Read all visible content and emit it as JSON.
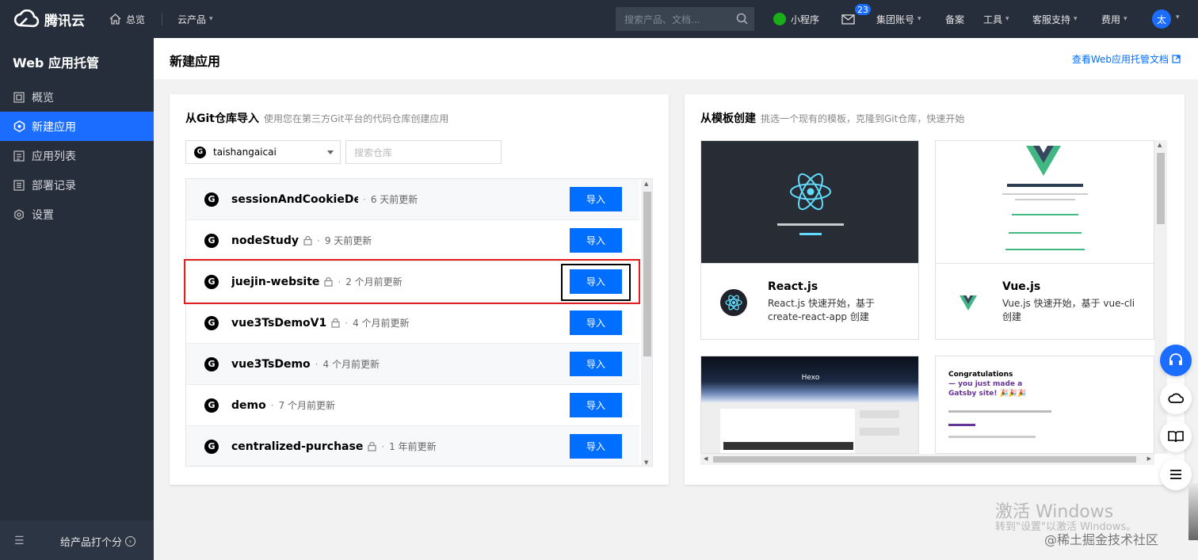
{
  "topbar": {
    "logo": "腾讯云",
    "home": "总览",
    "products": "云产品",
    "search_placeholder": "搜索产品、文档...",
    "miniprogram": "小程序",
    "message_badge": "23",
    "account": "集团账号",
    "filing": "备案",
    "tools": "工具",
    "support": "客服支持",
    "billing": "费用",
    "avatar": "太"
  },
  "sidebar": {
    "title": "Web 应用托管",
    "items": [
      {
        "label": "概览"
      },
      {
        "label": "新建应用"
      },
      {
        "label": "应用列表"
      },
      {
        "label": "部署记录"
      },
      {
        "label": "设置"
      }
    ],
    "rate": "给产品打个分"
  },
  "header": {
    "title": "新建应用",
    "doc_link": "查看Web应用托管文档"
  },
  "git_card": {
    "title": "从Git仓库导入",
    "subtitle": "使用您在第三方Git平台的代码仓库创建应用",
    "account": "taishangaicai",
    "search_placeholder": "搜索仓库",
    "import_label": "导入",
    "repos": [
      {
        "name": "sessionAndCookieDe...",
        "time": "6 天前更新"
      },
      {
        "name": "nodeStudy",
        "time": "9 天前更新"
      },
      {
        "name": "juejin-website",
        "time": "2 个月前更新"
      },
      {
        "name": "vue3TsDemoV1",
        "time": "4 个月前更新"
      },
      {
        "name": "vue3TsDemo",
        "time": "4 个月前更新"
      },
      {
        "name": "demo",
        "time": "7 个月前更新"
      },
      {
        "name": "centralized-purchase",
        "time": "1 年前更新"
      }
    ]
  },
  "template_card": {
    "title": "从模板创建",
    "subtitle": "挑选一个现有的模板，克隆到Git仓库，快速开始",
    "templates": [
      {
        "name": "React.js",
        "desc": "React.js 快速开始，基于 create-react-app 创建"
      },
      {
        "name": "Vue.js",
        "desc": "Vue.js 快速开始，基于 vue-cli 创建"
      }
    ],
    "hexo_label": "Hexo",
    "gatsby": {
      "line1": "Congratulations",
      "line2": "— you just made a",
      "line3": "Gatsby site! 🎉🎉🎉"
    }
  },
  "watermark": {
    "line1": "激活 Windows",
    "line2": "转到\"设置\"以激活 Windows。",
    "line3": "@稀土掘金技术社区"
  },
  "colors": {
    "primary": "#006eff",
    "sidebar": "#262e3b",
    "highlight_red": "#e02020"
  }
}
